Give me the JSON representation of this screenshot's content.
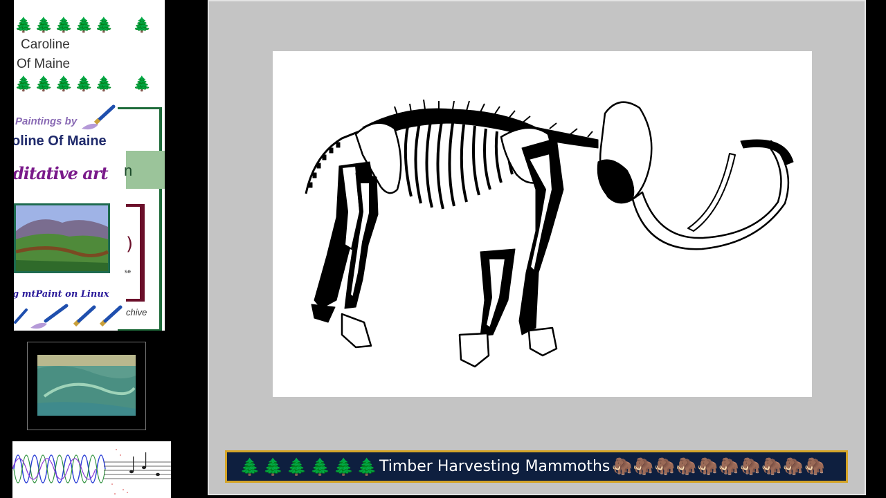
{
  "left_panel": {
    "tree_glyph": "🌲",
    "artist_first_line": "Caroline",
    "artist_second_line": "Of Maine",
    "paintings_by": "Paintings by",
    "artist_name": "oline Of Maine",
    "tagline": "ditative art",
    "block_letter": "n",
    "mtpaint_label": "g mtPaint on Linux",
    "archive_label": "chive",
    "maroon_glyph": ")",
    "maroon_small": "se"
  },
  "slide": {
    "image_subject": "mammoth-skeleton",
    "caption": {
      "trees": "🌲🌲🌲🌲🌲🌲",
      "title": "Timber Harvesting Mammoths",
      "mammoths": "🦣🦣🦣🦣🦣🦣🦣🦣🦣🦣"
    }
  },
  "colors": {
    "slide_background": "#c4c4c4",
    "caption_background": "#0e1f3f",
    "caption_border": "#d4a428",
    "tree_green": "#1e7d2e"
  }
}
